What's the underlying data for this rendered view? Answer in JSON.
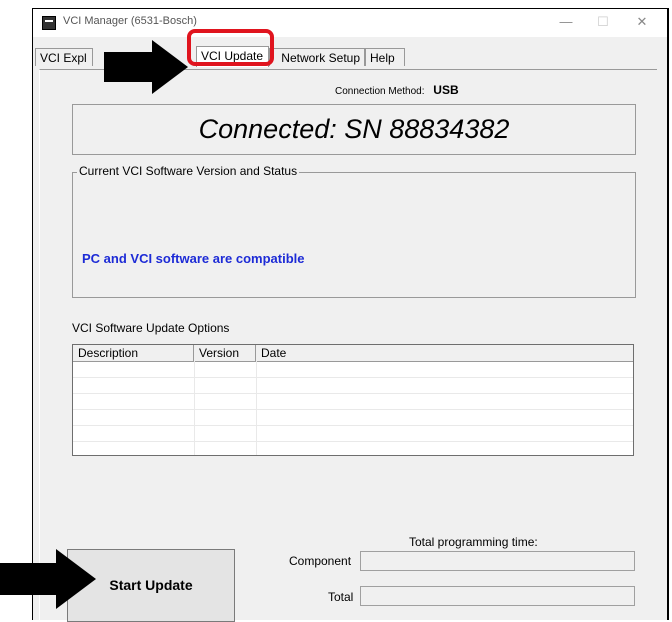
{
  "window": {
    "title": "VCI Manager (6531-Bosch)",
    "minimize_glyph": "—",
    "maximize_glyph": "☐",
    "close_glyph": "✕"
  },
  "tabs": [
    {
      "label": "VCI Explorer",
      "visible_label": "VCI Expl",
      "active": false
    },
    {
      "label": "VCI Update",
      "active": true
    },
    {
      "label": "Network Setup",
      "visible_label": "Network Setup",
      "active": false
    },
    {
      "label": "Help",
      "active": false
    }
  ],
  "connection": {
    "method_label": "Connection Method:",
    "method_value": "USB",
    "status": "Connected: SN 88834382"
  },
  "software_status": {
    "legend": "Current VCI Software Version and Status",
    "message": "PC and VCI software are compatible",
    "message_color": "#1d2bd6"
  },
  "update_options": {
    "label": "VCI Software Update Options",
    "columns": [
      "Description",
      "Version",
      "Date"
    ],
    "rows": []
  },
  "programming": {
    "total_time_label": "Total programming time:",
    "component_label": "Component",
    "total_label": "Total",
    "component_value": "",
    "total_value": ""
  },
  "actions": {
    "start_update_label": "Start Update"
  },
  "annotations": {
    "highlight_color": "#e0141e",
    "arrow_color": "#000000"
  }
}
